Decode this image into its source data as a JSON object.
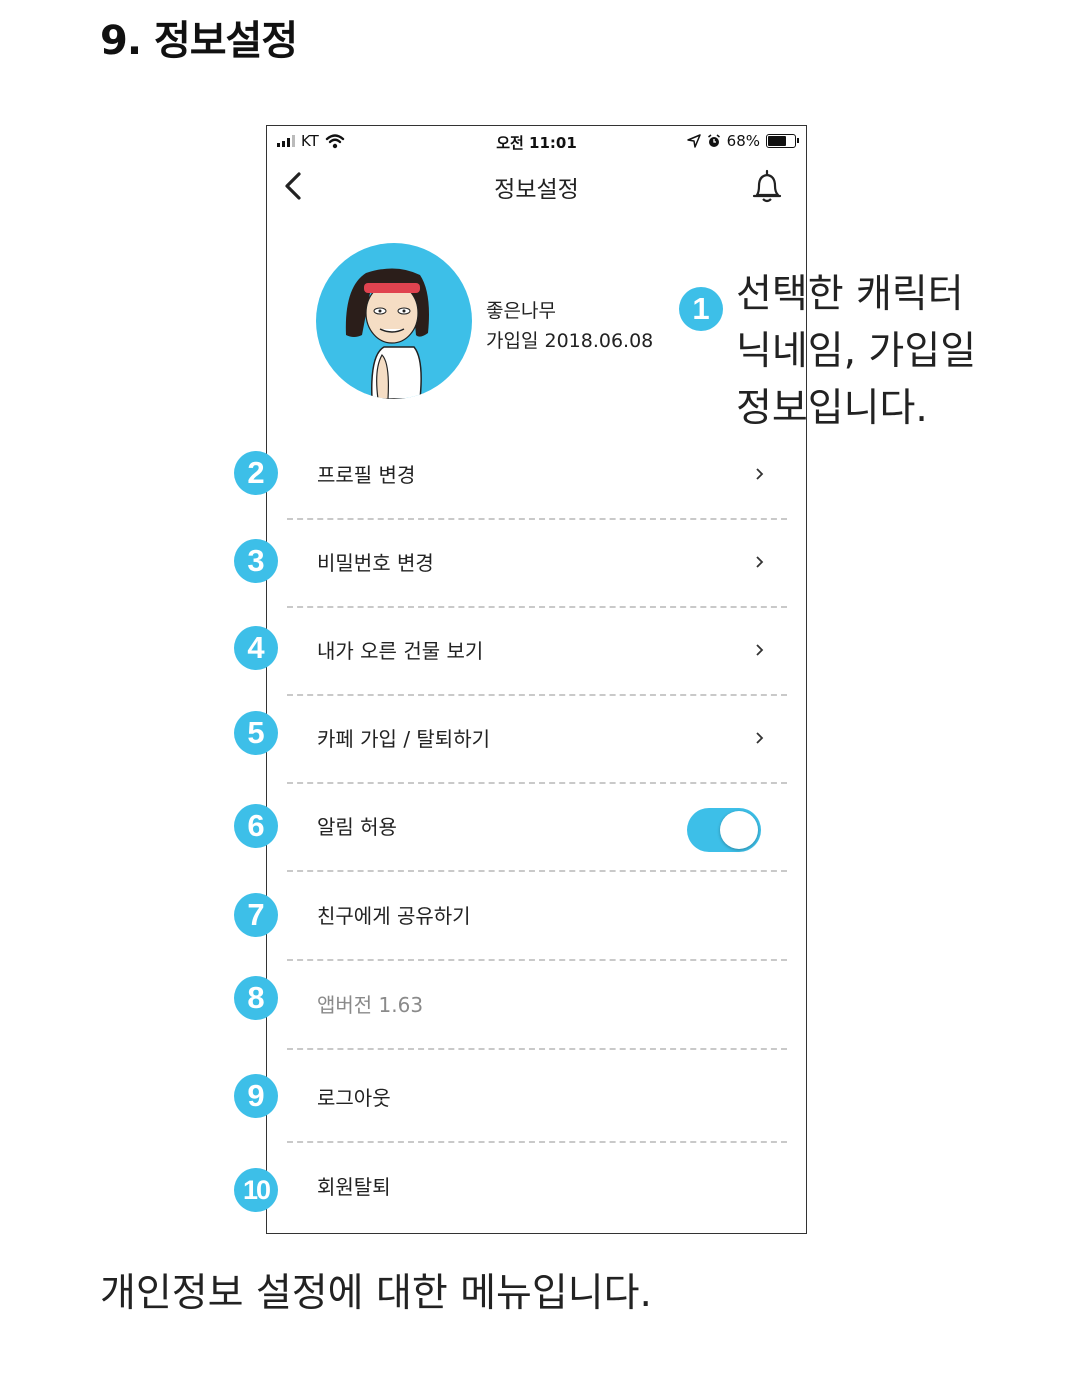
{
  "doc_title": "9. 정보설정",
  "status_bar": {
    "carrier": "KT",
    "time": "오전 11:01",
    "battery_text": "68%",
    "battery_level": 0.68
  },
  "nav": {
    "title": "정보설정"
  },
  "profile": {
    "nickname": "좋은나무",
    "join_line": "가입일 2018.06.08"
  },
  "badges": [
    "1",
    "2",
    "3",
    "4",
    "5",
    "6",
    "7",
    "8",
    "9",
    "10"
  ],
  "menu": [
    {
      "label": "프로필 변경"
    },
    {
      "label": "비밀번호 변경"
    },
    {
      "label": "내가 오른 건물 보기"
    },
    {
      "label": "카페 가입 / 탈퇴하기"
    },
    {
      "label": "알림 허용",
      "toggle_on": true
    },
    {
      "label": "친구에게 공유하기"
    },
    {
      "label": "앱버전  1.63"
    },
    {
      "label": "로그아웃"
    },
    {
      "label": "회원탈퇴"
    }
  ],
  "callout": {
    "line1": "선택한 캐릭터",
    "line2": "닉네임, 가입일",
    "line3": "정보입니다."
  },
  "footer_note": "개인정보 설정에 대한 메뉴입니다.",
  "colors": {
    "accent": "#3dbfe8",
    "divider": "#c9c9c9",
    "text": "#222222"
  }
}
